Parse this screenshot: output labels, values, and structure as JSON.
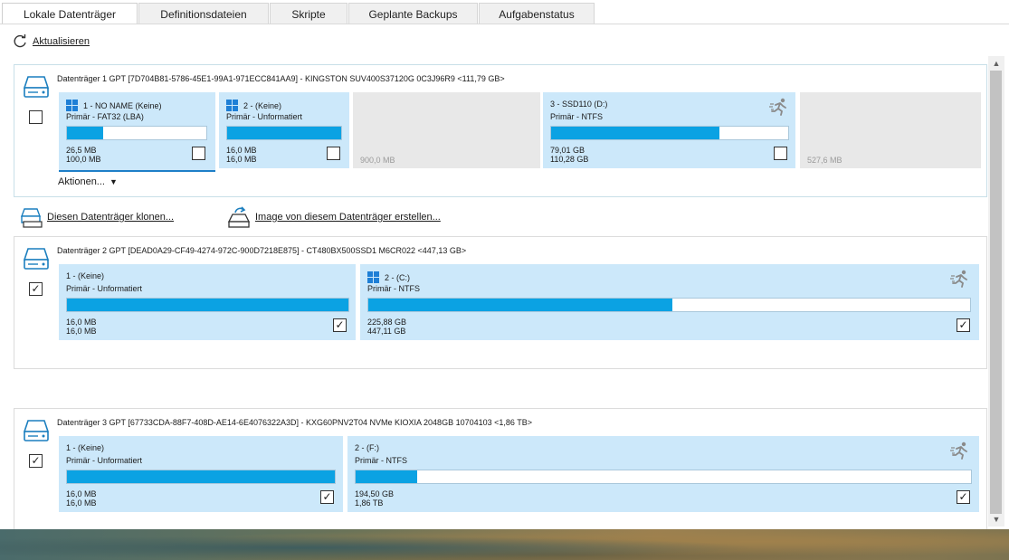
{
  "tabs": [
    {
      "label": "Lokale Datenträger",
      "active": true
    },
    {
      "label": "Definitionsdateien",
      "active": false
    },
    {
      "label": "Skripte",
      "active": false
    },
    {
      "label": "Geplante Backups",
      "active": false
    },
    {
      "label": "Aufgabenstatus",
      "active": false
    }
  ],
  "toolbar": {
    "refresh_label": "Aktualisieren"
  },
  "disk1": {
    "header": "Datenträger 1 GPT [7D704B81-5786-45E1-99A1-971ECC841AA9] - KINGSTON SUV400S37120G 0C3J96R9  <111,79 GB>",
    "checked": false,
    "actions_label": "Aktionen...",
    "partitions": [
      {
        "name": "1 - NO NAME (Keine)",
        "type": "Primär - FAT32 (LBA)",
        "used": "26,5 MB",
        "total": "100,0 MB",
        "fill": 0.26,
        "checked": false,
        "windows": true
      },
      {
        "name": "2 -  (Keine)",
        "type": "Primär - Unformatiert",
        "used": "16,0 MB",
        "total": "16,0 MB",
        "fill": 1.0,
        "checked": false,
        "windows": true
      },
      {
        "size": "900,0 MB"
      },
      {
        "name": "3 - SSD110 (D:)",
        "type": "Primär - NTFS",
        "used": "79,01 GB",
        "total": "110,28 GB",
        "fill": 0.71,
        "checked": false,
        "windows": false
      },
      {
        "size": "527,6 MB"
      }
    ]
  },
  "links": {
    "clone_label": "Diesen Datenträger klonen...",
    "image_label": "Image von diesem Datenträger erstellen..."
  },
  "disk2": {
    "header": "Datenträger 2 GPT [DEAD0A29-CF49-4274-972C-900D7218E875] - CT480BX500SSD1  M6CR022  <447,13 GB>",
    "checked": true,
    "partitions": [
      {
        "name": "1 -  (Keine)",
        "type": "Primär - Unformatiert",
        "used": "16,0 MB",
        "total": "16,0 MB",
        "fill": 1.0,
        "checked": true
      },
      {
        "name": "2 -  (C:)",
        "type": "Primär - NTFS",
        "used": "225,88 GB",
        "total": "447,11 GB",
        "fill": 0.505,
        "checked": true
      }
    ]
  },
  "disk3": {
    "header": "Datenträger 3 GPT [67733CDA-88F7-408D-AE14-6E4076322A3D] - KXG60PNV2T04 NVMe KIOXIA 2048GB 10704103  <1,86 TB>",
    "checked": true,
    "partitions": [
      {
        "name": "1 -  (Keine)",
        "type": "Primär - Unformatiert",
        "used": "16,0 MB",
        "total": "16,0 MB",
        "fill": 1.0,
        "checked": true
      },
      {
        "name": "2 -  (F:)",
        "type": "Primär - NTFS",
        "used": "194,50 GB",
        "total": "1,86 TB",
        "fill": 0.1,
        "checked": true
      }
    ]
  },
  "colors": {
    "accent": "#0ba2e3",
    "partition_bg": "#cce8fa",
    "unallocated_bg": "#e8e8e8"
  }
}
